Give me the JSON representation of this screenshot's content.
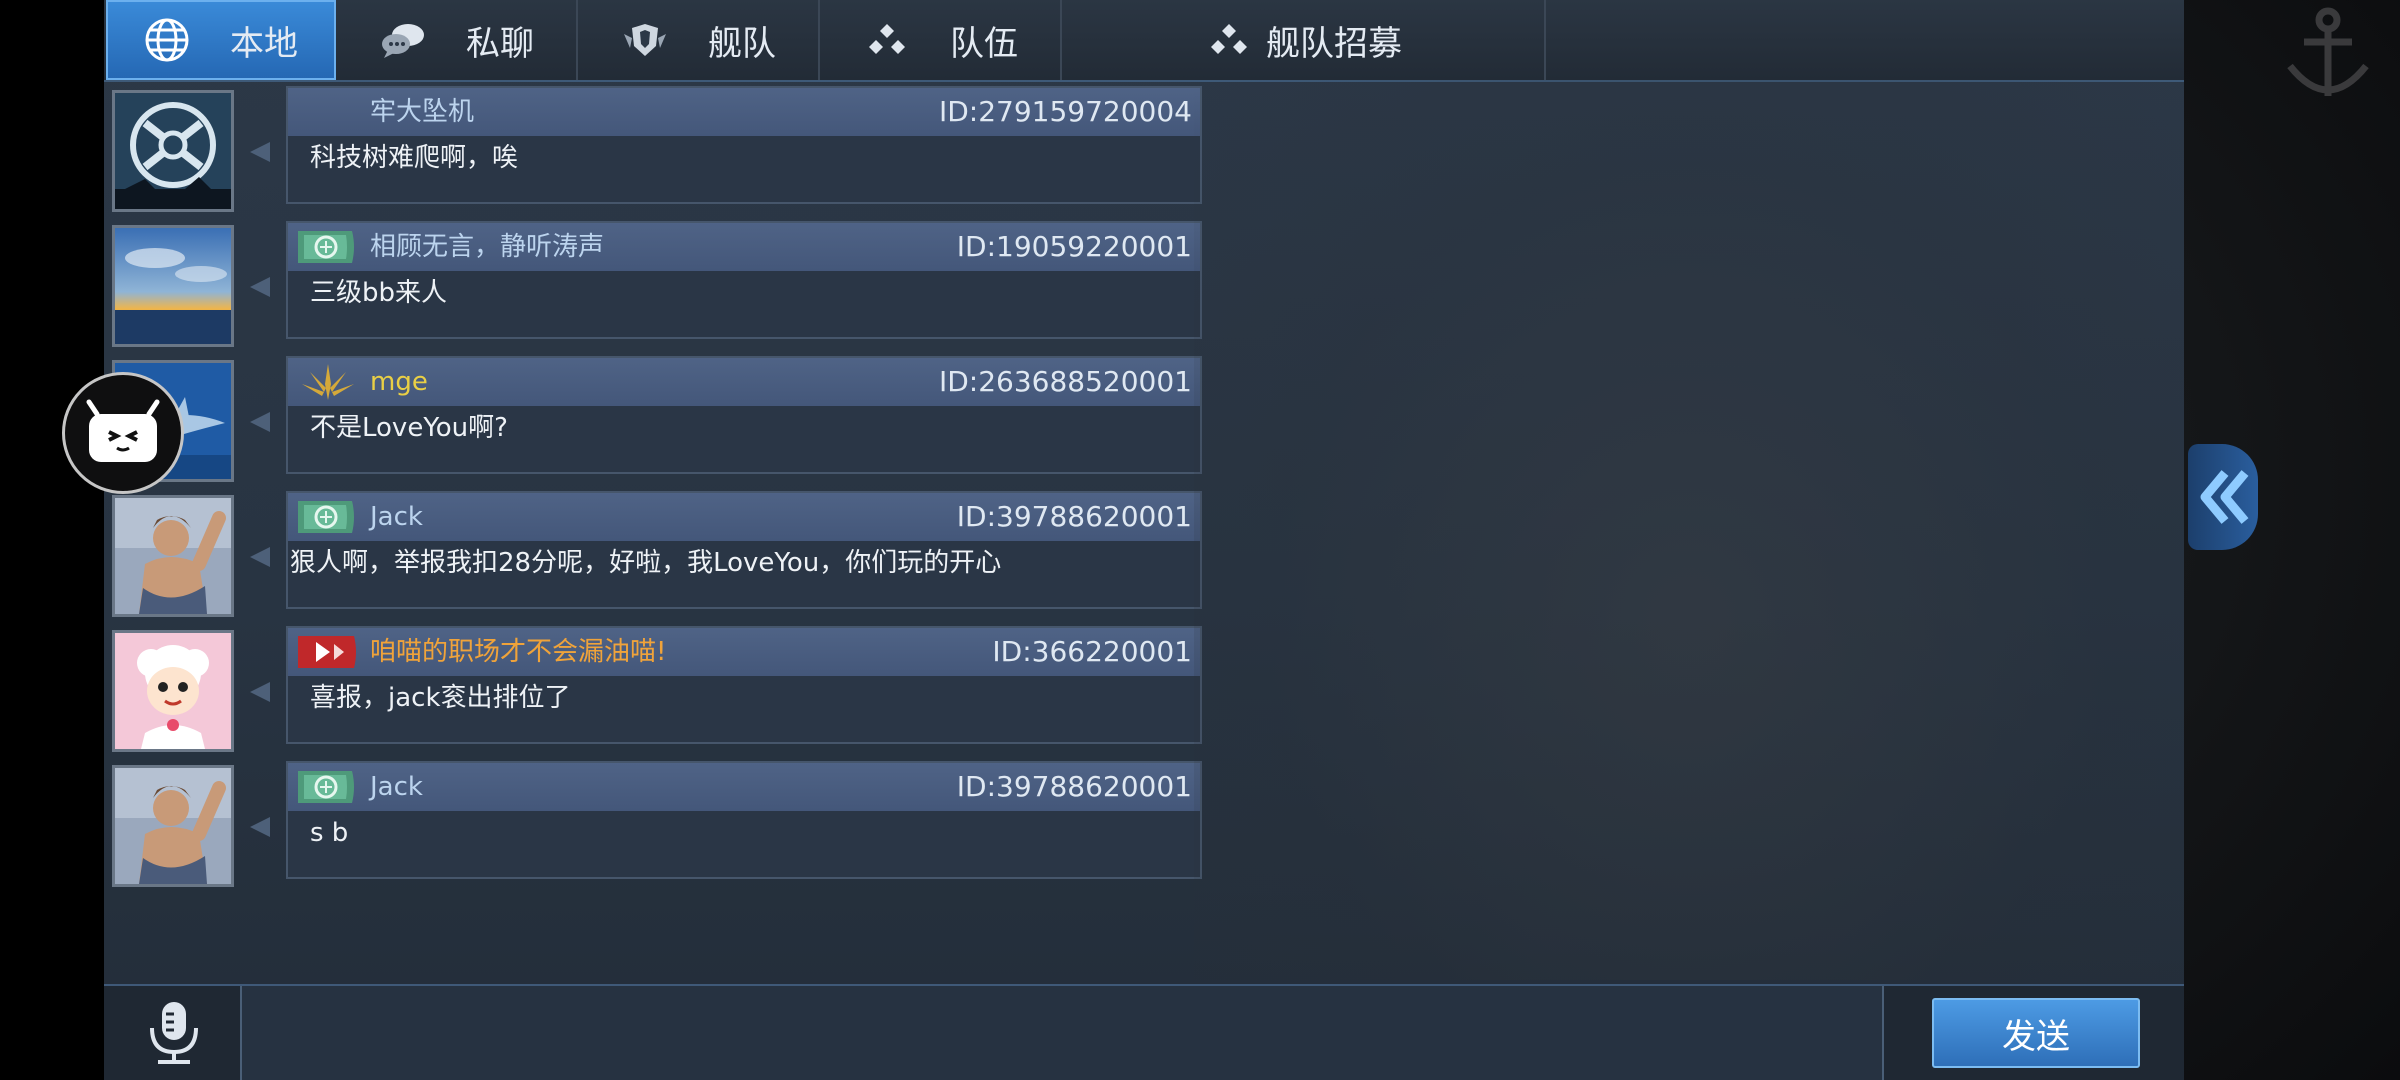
{
  "tabs": [
    {
      "label": "本地",
      "icon": "globe-icon",
      "active": true
    },
    {
      "label": "私聊",
      "icon": "chat-bubbles-icon",
      "active": false
    },
    {
      "label": "舰队",
      "icon": "fleet-emblem-icon",
      "active": false
    },
    {
      "label": "队伍",
      "icon": "team-dots-icon",
      "active": false
    },
    {
      "label": "舰队招募",
      "icon": "team-dots-icon",
      "active": false
    }
  ],
  "messages": [
    {
      "name": "牢大坠机",
      "id": "ID:279159720004",
      "text": "科技树难爬啊，唉",
      "name_color": "#bcd4ee",
      "badge": "none",
      "avatar": "ship-emblem-avatar"
    },
    {
      "name": "相顾无言，静听涛声",
      "id": "ID:19059220001",
      "text": "三级bb来人",
      "name_color": "#bcd4ee",
      "badge": "green-flag",
      "avatar": "sunset-sea-avatar"
    },
    {
      "name": "mge",
      "id": "ID:263688520001",
      "text": "不是LoveYou啊?",
      "name_color": "#e9cf45",
      "badge": "gold-crest",
      "avatar": "shark-avatar"
    },
    {
      "name": "Jack",
      "id": "ID:39788620001",
      "text": "狠人啊，举报我扣28分呢，好啦，我LoveYou，你们玩的开心",
      "name_color": "#bcd4ee",
      "badge": "green-flag",
      "avatar": "warrior-avatar"
    },
    {
      "name": "咱喵的职场才不会漏油喵!",
      "id": "ID:366220001",
      "text": "喜报，jack衮出排位了",
      "name_color": "#f0a33a",
      "badge": "red-flag",
      "avatar": "sheep-cartoon-avatar"
    },
    {
      "name": "Jack",
      "id": "ID:39788620001",
      "text": "s b",
      "name_color": "#bcd4ee",
      "badge": "green-flag",
      "avatar": "warrior-avatar"
    }
  ],
  "input": {
    "value": "",
    "placeholder": ""
  },
  "send_label": "发送",
  "colors": {
    "accent": "#2e6fb8",
    "panel": "#283442",
    "header": "#4a5e80"
  }
}
